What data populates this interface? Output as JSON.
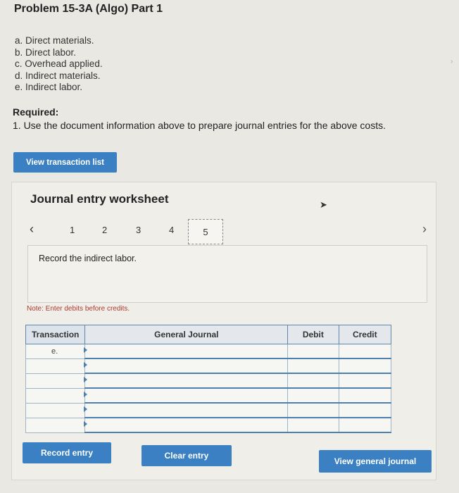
{
  "page": {
    "title": "Problem 15-3A (Algo) Part 1"
  },
  "items": [
    "a. Direct materials.",
    "b. Direct labor.",
    "c. Overhead applied.",
    "d. Indirect materials.",
    "e. Indirect labor."
  ],
  "required": {
    "label": "Required:",
    "text": "1. Use the document information above to prepare journal entries for the above costs."
  },
  "buttons": {
    "view_transaction_list": "View transaction list",
    "record_entry": "Record entry",
    "clear_entry": "Clear entry",
    "view_general_journal": "View general journal"
  },
  "worksheet": {
    "title": "Journal entry worksheet",
    "pages": [
      "1",
      "2",
      "3",
      "4"
    ],
    "active_page": "5",
    "instruction": "Record the indirect labor.",
    "note_label": "Note: Enter debits before credits."
  },
  "journal": {
    "headers": {
      "transaction": "Transaction",
      "general_journal": "General Journal",
      "debit": "Debit",
      "credit": "Credit"
    },
    "rows": [
      {
        "transaction": "e."
      },
      {
        "transaction": ""
      },
      {
        "transaction": ""
      },
      {
        "transaction": ""
      },
      {
        "transaction": ""
      },
      {
        "transaction": ""
      }
    ]
  },
  "colors": {
    "accent": "#3a80c3",
    "table_border": "#4f7fb0",
    "note": "#b03a2e"
  }
}
